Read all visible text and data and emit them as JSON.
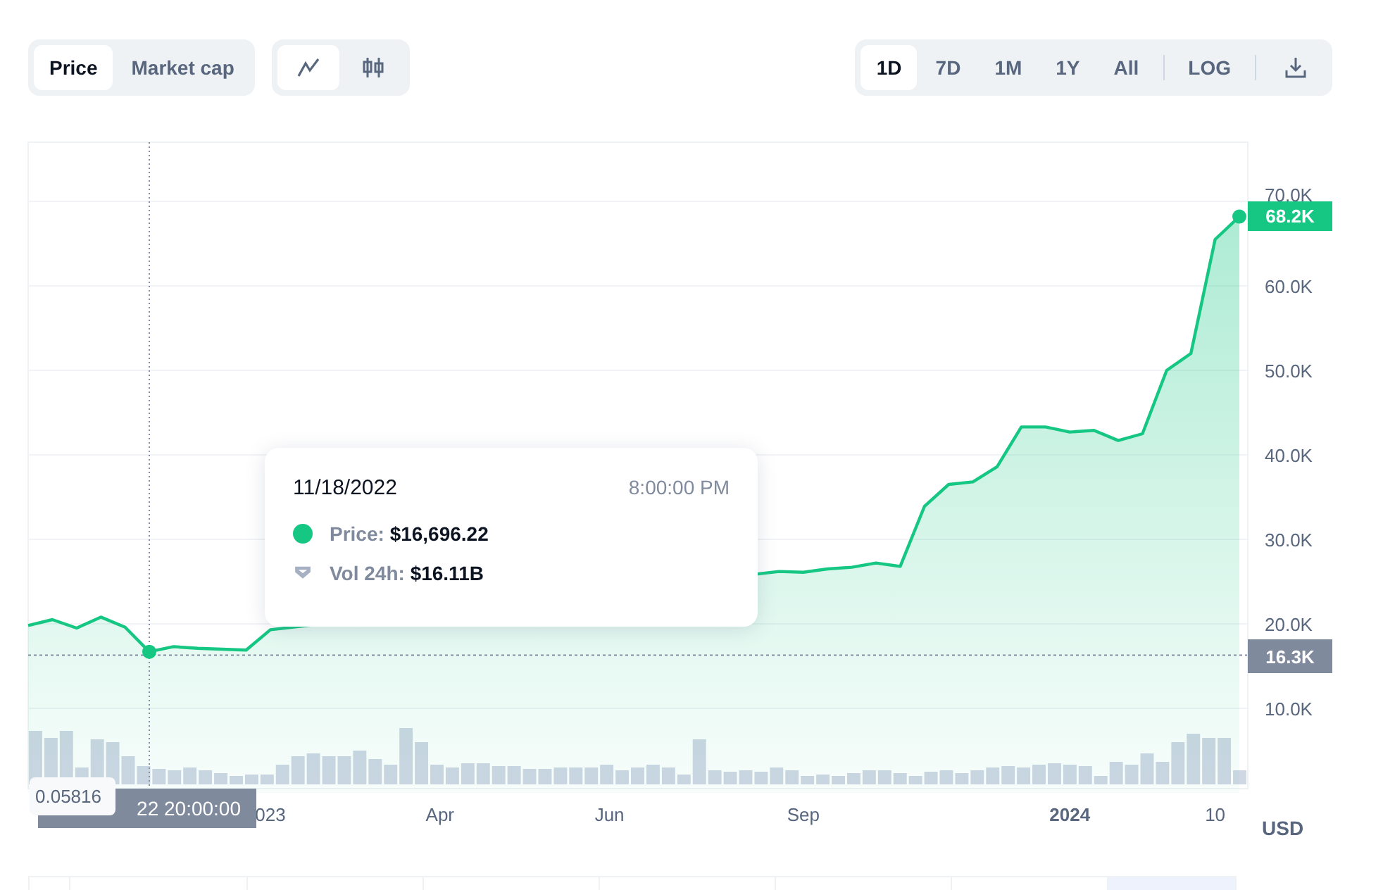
{
  "toolbar": {
    "metric_tabs": [
      {
        "label": "Price",
        "selected": true
      },
      {
        "label": "Market cap",
        "selected": false
      }
    ],
    "chart_type_tabs": [
      {
        "kind": "line",
        "selected": true
      },
      {
        "kind": "candles",
        "selected": false
      }
    ],
    "range_tabs": [
      {
        "label": "1D",
        "selected": true
      },
      {
        "label": "7D",
        "selected": false
      },
      {
        "label": "1M",
        "selected": false
      },
      {
        "label": "1Y",
        "selected": false
      },
      {
        "label": "All",
        "selected": false
      }
    ],
    "scale_button": "LOG"
  },
  "chart": {
    "chart_data": {
      "type": "area",
      "grid": true,
      "ylim": [
        0,
        77000
      ],
      "ref_lines": [
        {
          "axis": "y",
          "value": 16300
        }
      ],
      "yticks": [
        {
          "value": 10000,
          "label": "10.0K"
        },
        {
          "value": 20000,
          "label": "20.0K"
        },
        {
          "value": 30000,
          "label": "30.0K"
        },
        {
          "value": 40000,
          "label": "40.0K"
        },
        {
          "value": 50000,
          "label": "50.0K"
        },
        {
          "value": 60000,
          "label": "60.0K"
        },
        {
          "value": 70000,
          "label": "70.0K"
        }
      ],
      "categories": [
        null,
        null,
        null,
        null,
        null,
        null,
        null,
        null,
        null,
        null,
        "023",
        null,
        null,
        null,
        null,
        null,
        null,
        "Apr",
        null,
        null,
        null,
        null,
        null,
        null,
        "Jun",
        null,
        null,
        null,
        null,
        null,
        null,
        null,
        "Sep",
        null,
        null,
        null,
        null,
        null,
        null,
        null,
        null,
        null,
        null,
        "2024",
        null,
        null,
        null,
        null,
        null,
        "10",
        null
      ],
      "series": [
        {
          "color": "#16c784",
          "values": [
            19800,
            20500,
            19500,
            20800,
            19600,
            16700,
            17300,
            17100,
            17000,
            16900,
            19300,
            null,
            null,
            null,
            null,
            null,
            null,
            null,
            null,
            null,
            null,
            null,
            null,
            null,
            null,
            null,
            null,
            null,
            null,
            null,
            null,
            26200,
            26100,
            26500,
            26700,
            27200,
            26800,
            33900,
            36500,
            36800,
            38600,
            43300,
            43300,
            42700,
            42900,
            41700,
            42500,
            50000,
            52000,
            65500,
            68200
          ]
        }
      ]
    },
    "last_price_badge": "68.2K",
    "crosshair_price_badge": "16.3K",
    "crosshair_volume_badge": "0.05816",
    "crosshair_time_badge": "22 20:00:00",
    "currency": "USD"
  },
  "tooltip": {
    "date": "11/18/2022",
    "time": "8:00:00 PM",
    "rows": [
      {
        "kind": "price",
        "label": "Price:",
        "value": "$16,696.22",
        "color": "#16c784"
      },
      {
        "kind": "volume",
        "label": "Vol 24h:",
        "value": "$16.11B"
      }
    ]
  }
}
